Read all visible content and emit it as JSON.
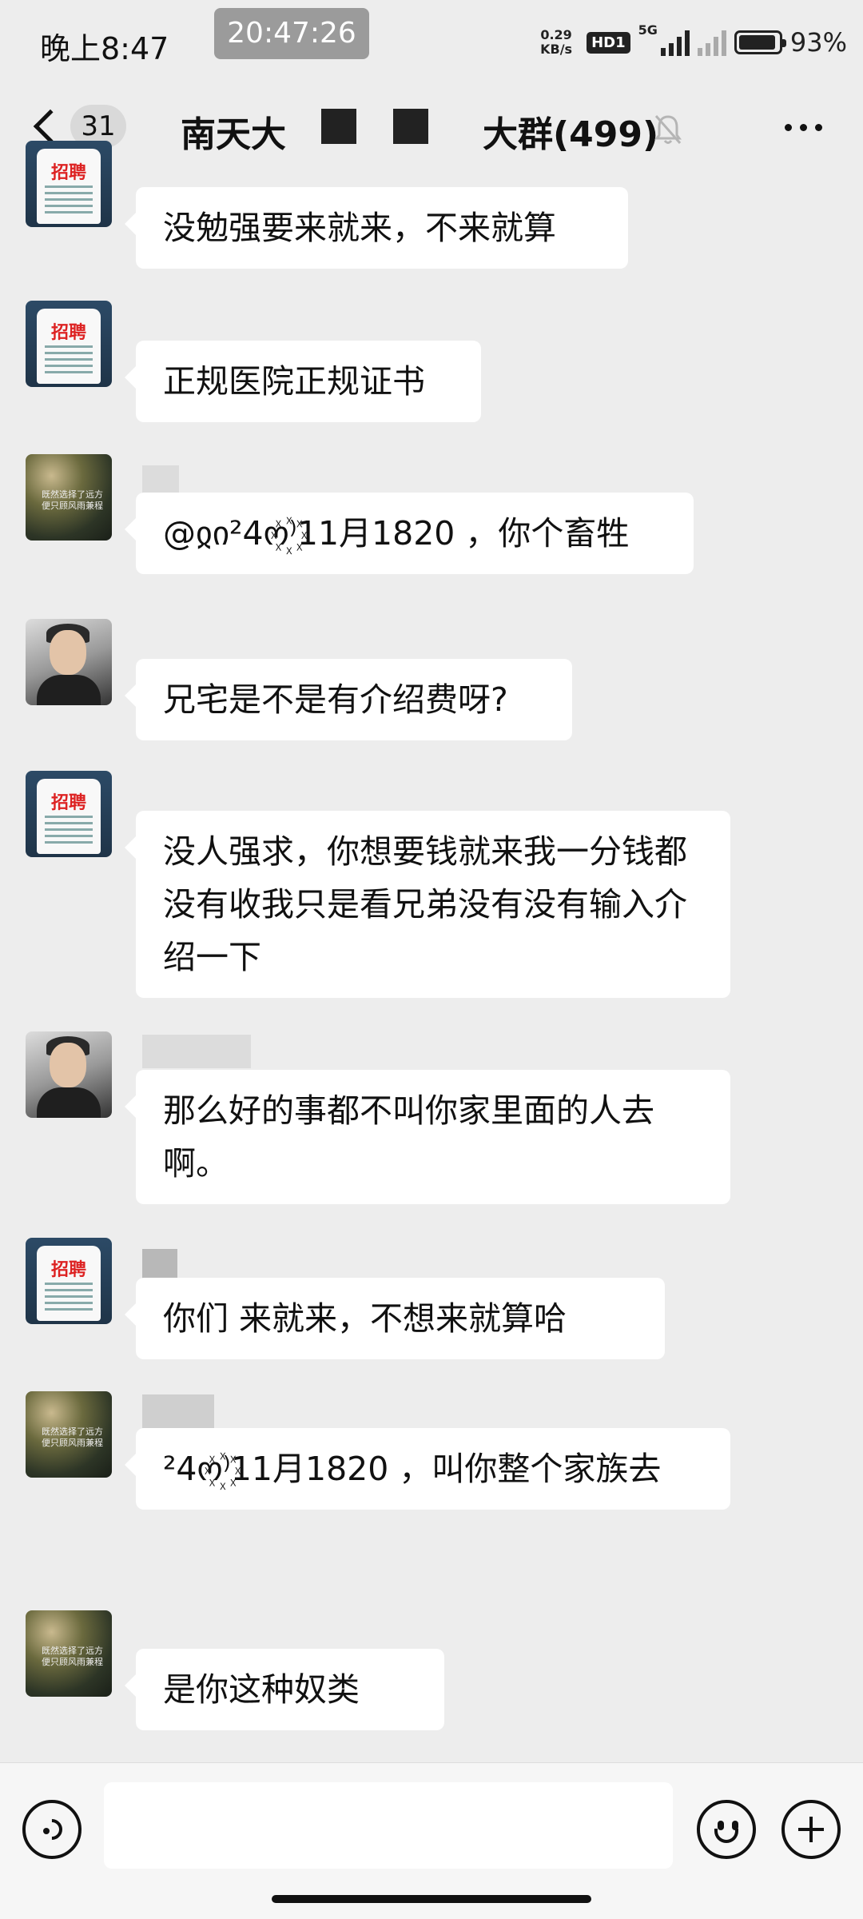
{
  "status_bar": {
    "time": "晚上8:47",
    "overlay_time": "20:47:26",
    "net_speed_value": "0.29",
    "net_speed_unit": "KB/s",
    "hd_label": "HD1",
    "network_label": "5G",
    "battery_percent": "93%"
  },
  "header": {
    "back_icon": "chevron-left-icon",
    "unread_count": "31",
    "title_left": "南天大",
    "title_right": "大群(499)",
    "mute_icon": "bell-muted-icon",
    "more_icon": "more-horizontal-icon"
  },
  "messages": [
    {
      "avatar": "recruit",
      "text": "没勉强要来就来，不来就算"
    },
    {
      "avatar": "recruit",
      "text": "正规医院正规证书"
    },
    {
      "avatar": "nature",
      "text": "@ჲი²4ო꙰⁾11月1820 ，你个畜牲"
    },
    {
      "avatar": "person",
      "text": "兄宅是不是有介绍费呀?"
    },
    {
      "avatar": "recruit",
      "text": "没人强求，你想要钱就来我一分钱都没有收我只是看兄弟没有没有输入介绍一下"
    },
    {
      "avatar": "person",
      "text": "那么好的事都不叫你家里面的人去啊。"
    },
    {
      "avatar": "recruit",
      "text": "你们  来就来，不想来就算哈"
    },
    {
      "avatar": "nature",
      "text": "   ²4ო꙰⁾11月1820 ，叫你整个家族去"
    },
    {
      "avatar": "nature",
      "text": "  是你这种奴类"
    }
  ],
  "input_bar": {
    "voice_icon": "voice-icon",
    "emoji_icon": "emoji-icon",
    "plus_icon": "plus-icon",
    "placeholder": ""
  }
}
